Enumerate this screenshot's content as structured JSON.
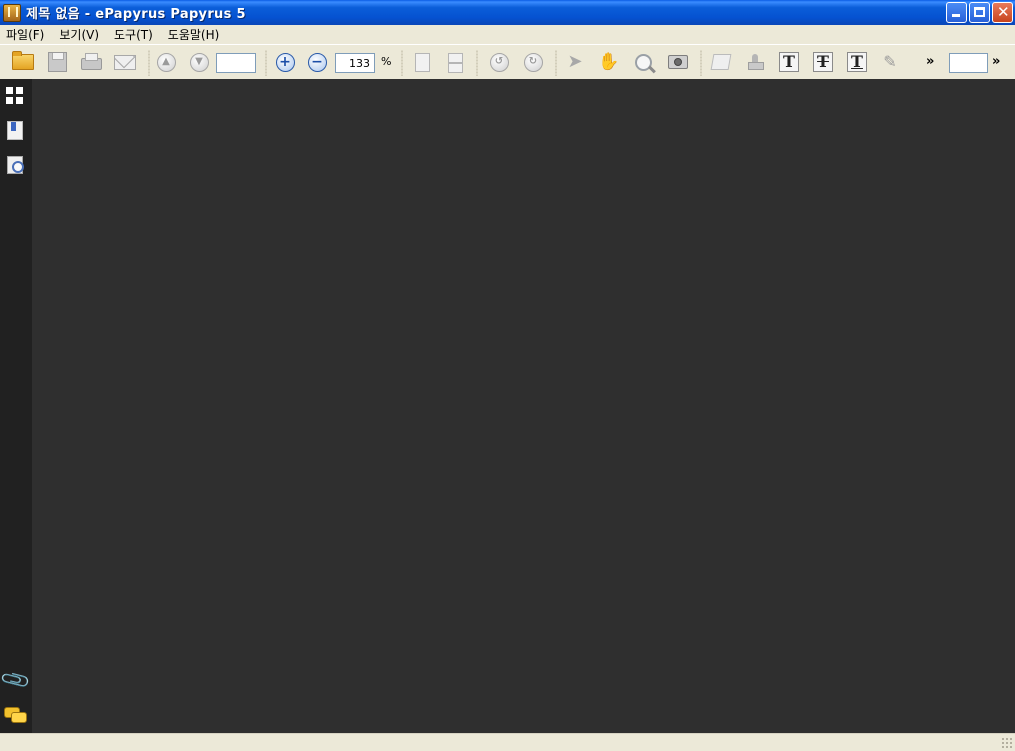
{
  "window": {
    "title": "제목 없음 - ePapyrus Papyrus 5"
  },
  "menu": {
    "items": [
      "파일(F)",
      "보기(V)",
      "도구(T)",
      "도움말(H)"
    ]
  },
  "toolbar": {
    "page_number": "",
    "zoom_value": "133",
    "zoom_unit": "%",
    "overflow_chevron": "»",
    "search_value": "",
    "search_chevron": "»",
    "text_tool_letter": "T"
  },
  "sidebar": {
    "top_tools": [
      "thumbnails-icon",
      "bookmarks-icon",
      "search-document-icon"
    ],
    "bottom_tools": [
      "paperclip-icon",
      "comments-icon"
    ]
  },
  "colors": {
    "titlebar": "#0b5ed9",
    "document_background": "#2f2f2f",
    "sidebar_background": "#212121",
    "chrome": "#ece9d8"
  }
}
